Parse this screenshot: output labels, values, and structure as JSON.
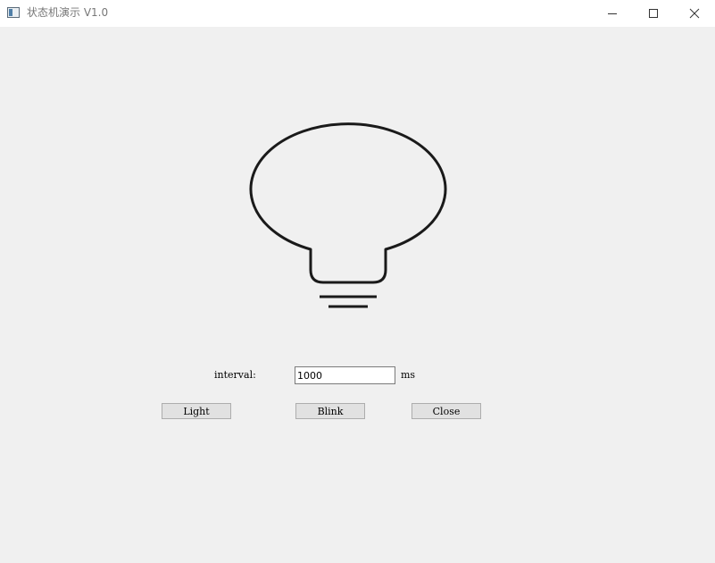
{
  "window": {
    "title": "状态机演示 V1.0",
    "icons": {
      "app": "app-window-icon",
      "minimize": "minimize-icon",
      "maximize": "maximize-icon",
      "close": "close-icon"
    }
  },
  "main": {
    "bulb_icon": "lightbulb-off-icon",
    "interval_label": "interval:",
    "interval_value": "1000",
    "interval_unit": "ms",
    "buttons": {
      "light": "Light",
      "blink": "Blink",
      "close": "Close"
    }
  },
  "colors": {
    "window_background": "#f0f0f0",
    "titlebar_background": "#ffffff",
    "button_face": "#e1e1e1"
  }
}
